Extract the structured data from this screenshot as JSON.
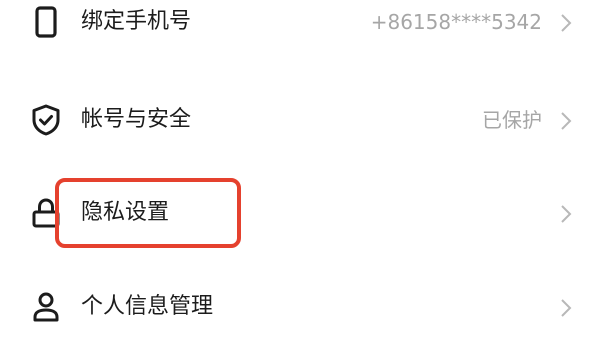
{
  "settings": {
    "items": [
      {
        "label": "绑定手机号",
        "value": "+86158****5342",
        "icon": "phone-icon"
      },
      {
        "label": "帐号与安全",
        "value": "已保护",
        "icon": "shield-check-icon"
      },
      {
        "label": "隐私设置",
        "value": "",
        "icon": "lock-icon"
      },
      {
        "label": "个人信息管理",
        "value": "",
        "icon": "person-icon"
      }
    ],
    "highlighted_item": "隐私设置"
  },
  "colors": {
    "text_primary": "#1c1c1c",
    "text_secondary": "#a6a6a6",
    "highlight_border": "#e5412e",
    "background": "#ffffff"
  }
}
